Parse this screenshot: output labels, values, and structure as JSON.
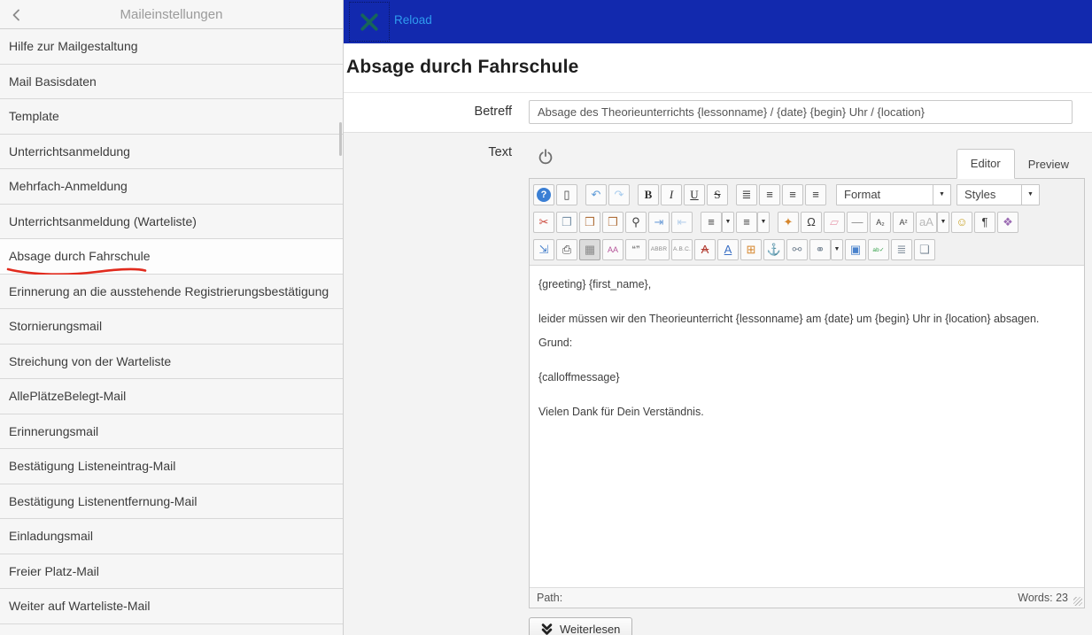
{
  "colors": {
    "topbar_blue": "#1229ae",
    "reload_link": "#2f9bef",
    "close_x": "#17655a",
    "annotation_red": "#e12b1e",
    "sidebar_bg": "#f6f6f6",
    "form_bg": "#f3f3f3"
  },
  "sidebar": {
    "back_icon": "chevron-left",
    "title": "Maileinstellungen",
    "items": [
      {
        "label": "Hilfe zur Mailgestaltung"
      },
      {
        "label": "Mail Basisdaten"
      },
      {
        "label": "Template"
      },
      {
        "label": "Unterrichtsanmeldung"
      },
      {
        "label": "Mehrfach-Anmeldung"
      },
      {
        "label": "Unterrichtsanmeldung (Warteliste)"
      },
      {
        "label": "Absage durch Fahrschule",
        "selected": true,
        "annotated": true
      },
      {
        "label": "Erinnerung an die ausstehende Registrierungsbestätigung"
      },
      {
        "label": "Stornierungsmail"
      },
      {
        "label": "Streichung von der Warteliste"
      },
      {
        "label": "AllePlätzeBelegt-Mail"
      },
      {
        "label": "Erinnerungsmail"
      },
      {
        "label": "Bestätigung Listeneintrag-Mail"
      },
      {
        "label": "Bestätigung Listenentfernung-Mail"
      },
      {
        "label": "Einladungsmail"
      },
      {
        "label": "Freier Platz-Mail"
      },
      {
        "label": "Weiter auf Warteliste-Mail"
      }
    ]
  },
  "topbar": {
    "reload_label": "Reload"
  },
  "page": {
    "title": "Absage durch Fahrschule"
  },
  "form": {
    "betreff_label": "Betreff",
    "betreff_value": "Absage des Theorieunterrichts {lessonname} / {date} {begin} Uhr / {location}",
    "text_label": "Text"
  },
  "editor": {
    "tabs": [
      {
        "label": "Editor",
        "active": true
      },
      {
        "label": "Preview",
        "active": false
      }
    ],
    "toolbar": {
      "rows": [
        [
          {
            "t": "btn",
            "n": "help-icon",
            "g": "?",
            "c": "help"
          },
          {
            "t": "btn",
            "n": "new-document-icon",
            "g": "▯",
            "c": "dark"
          },
          {
            "t": "sep"
          },
          {
            "t": "btn",
            "n": "undo-icon",
            "g": "↶",
            "c": "undo"
          },
          {
            "t": "btn",
            "n": "redo-icon",
            "g": "↷",
            "c": "redo"
          },
          {
            "t": "sep"
          },
          {
            "t": "btn",
            "n": "bold-icon",
            "g": "B",
            "c": "bold"
          },
          {
            "t": "btn",
            "n": "italic-icon",
            "g": "I",
            "c": "italic"
          },
          {
            "t": "btn",
            "n": "underline-icon",
            "g": "U",
            "c": "underl"
          },
          {
            "t": "btn",
            "n": "strikethrough-icon",
            "g": "S",
            "c": "strike"
          },
          {
            "t": "sep"
          },
          {
            "t": "btn",
            "n": "justify-full-icon",
            "g": "≣",
            "c": "dark"
          },
          {
            "t": "btn",
            "n": "justify-center-icon",
            "g": "≡",
            "c": "dark"
          },
          {
            "t": "btn",
            "n": "justify-left-icon",
            "g": "≡",
            "c": "dark"
          },
          {
            "t": "btn",
            "n": "justify-right-icon",
            "g": "≡",
            "c": "dark"
          },
          {
            "t": "sep"
          },
          {
            "t": "select",
            "n": "format-select",
            "label": "Format",
            "w": 130
          },
          {
            "t": "select",
            "n": "styles-select",
            "label": "Styles",
            "w": 94
          }
        ],
        [
          {
            "t": "btn",
            "n": "cut-icon",
            "g": "✂",
            "c": "red"
          },
          {
            "t": "btn",
            "n": "copy-icon",
            "g": "❐",
            "c": "copy"
          },
          {
            "t": "btn",
            "n": "paste-icon",
            "g": "❒",
            "c": "paste"
          },
          {
            "t": "btn",
            "n": "paste-as-text-icon",
            "g": "❒",
            "c": "paste"
          },
          {
            "t": "btn",
            "n": "find-icon",
            "g": "⚲",
            "c": "dark"
          },
          {
            "t": "btn",
            "n": "indent-icon",
            "g": "⇥",
            "c": "indigo"
          },
          {
            "t": "btn",
            "n": "outdent-icon",
            "g": "⇤",
            "c": "indigo2"
          },
          {
            "t": "sep"
          },
          {
            "t": "btn",
            "n": "numbered-list-icon",
            "g": "≡",
            "c": "dark"
          },
          {
            "t": "caret",
            "n": "numbered-list-caret",
            "g": "▼"
          },
          {
            "t": "btn",
            "n": "bullet-list-icon",
            "g": "≡",
            "c": "dark"
          },
          {
            "t": "caret",
            "n": "bullet-list-caret",
            "g": "▼"
          },
          {
            "t": "sep"
          },
          {
            "t": "btn",
            "n": "cleanup-icon",
            "g": "✦",
            "c": "orange"
          },
          {
            "t": "btn",
            "n": "special-char-icon",
            "g": "Ω",
            "c": "dark"
          },
          {
            "t": "btn",
            "n": "remove-format-icon",
            "g": "▱",
            "c": "pink"
          },
          {
            "t": "btn",
            "n": "horizontal-rule-icon",
            "g": "—",
            "c": "gray"
          },
          {
            "t": "btn",
            "n": "subscript-icon",
            "g": "A₂",
            "c": "dark",
            "cls": "tiny2"
          },
          {
            "t": "btn",
            "n": "superscript-icon",
            "g": "A²",
            "c": "dark",
            "cls": "tiny2"
          },
          {
            "t": "btn",
            "n": "style-props-icon",
            "g": "aA",
            "c": "faded"
          },
          {
            "t": "caret",
            "n": "style-props-caret",
            "g": "▼"
          },
          {
            "t": "btn",
            "n": "emotions-icon",
            "g": "☺",
            "c": "gold"
          },
          {
            "t": "btn",
            "n": "paragraph-icon",
            "g": "¶",
            "c": "dark"
          },
          {
            "t": "btn",
            "n": "template-icon",
            "g": "❖",
            "c": "violet"
          }
        ],
        [
          {
            "t": "btn",
            "n": "fullscreen-icon",
            "g": "⇲",
            "c": "blue"
          },
          {
            "t": "btn",
            "n": "print-icon",
            "g": "⎙",
            "c": "dark"
          },
          {
            "t": "btn",
            "n": "table-icon",
            "g": "▦",
            "c": "gray",
            "sel": true
          },
          {
            "t": "btn",
            "n": "font-colors-icon",
            "g": "AA",
            "c": "magenta",
            "cls": "tiny2"
          },
          {
            "t": "btn",
            "n": "blockquote-icon",
            "g": "❝❞",
            "c": "gray",
            "cls": "tiny2"
          },
          {
            "t": "btn",
            "n": "cite-icon",
            "g": "ABBR",
            "c": "gray",
            "cls": "tiny"
          },
          {
            "t": "btn",
            "n": "acronym-icon",
            "g": "A.B.C.",
            "c": "gray",
            "cls": "tiny"
          },
          {
            "t": "btn",
            "n": "del-icon",
            "g": "A",
            "c": "del"
          },
          {
            "t": "btn",
            "n": "ins-icon",
            "g": "A",
            "c": "ins"
          },
          {
            "t": "btn",
            "n": "insert-date-icon",
            "g": "⊞",
            "c": "orange"
          },
          {
            "t": "btn",
            "n": "anchor-icon",
            "g": "⚓",
            "c": "slate"
          },
          {
            "t": "btn",
            "n": "unlink-icon",
            "g": "⚯",
            "c": "slate"
          },
          {
            "t": "btn",
            "n": "link-icon",
            "g": "⚭",
            "c": "slate"
          },
          {
            "t": "caret",
            "n": "link-caret",
            "g": "▼"
          },
          {
            "t": "btn",
            "n": "image-icon",
            "g": "▣",
            "c": "blue"
          },
          {
            "t": "btn",
            "n": "spellcheck-icon",
            "g": "ab✓",
            "c": "green",
            "cls": "tiny"
          },
          {
            "t": "btn",
            "n": "advanced-hr-icon",
            "g": "≣",
            "c": "slate"
          },
          {
            "t": "btn",
            "n": "insert-layer-icon",
            "g": "❏",
            "c": "slate"
          }
        ]
      ]
    },
    "paragraphs": [
      [
        "{greeting} {first_name},"
      ],
      [
        "leider müssen wir den Theorieunterricht {lessonname} am {date} um {begin} Uhr in {location} absagen.",
        "Grund:"
      ],
      [
        "{calloffmessage}"
      ],
      [
        "Vielen Dank für Dein Verständnis."
      ]
    ],
    "statusbar": {
      "path_label": "Path:",
      "words_label": "Words: 23"
    }
  },
  "readmore": {
    "label": "Weiterlesen"
  }
}
